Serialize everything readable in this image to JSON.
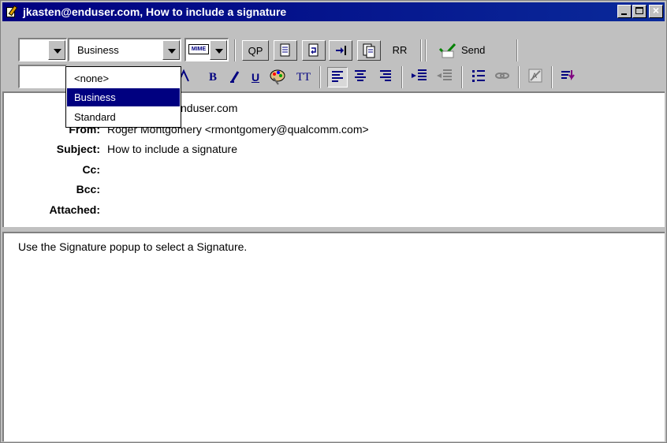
{
  "window": {
    "title": "jkasten@enduser.com, How to include a signature"
  },
  "toolbar1": {
    "priority_value": "",
    "signature_value": "Business",
    "mime_label": "MIME",
    "qp_label": "QP",
    "rr_label": "RR",
    "send_label": "Send"
  },
  "toolbar2": {
    "font_value": "",
    "bold_label": "B",
    "underline_label": "U",
    "tt_label": "TT"
  },
  "signature_dropdown": {
    "options": [
      "<none>",
      "Business",
      "Standard"
    ],
    "selected": "Business"
  },
  "headers": {
    "to_value_visible": "nduser.com",
    "from_label": "From:",
    "from_value": "Roger Montgomery <rmontgomery@qualcomm.com>",
    "subject_label": "Subject:",
    "subject_value": "How to include a signature",
    "cc_label": "Cc:",
    "bcc_label": "Bcc:",
    "attached_label": "Attached:"
  },
  "message": {
    "body": "Use the Signature popup to select a Signature."
  }
}
